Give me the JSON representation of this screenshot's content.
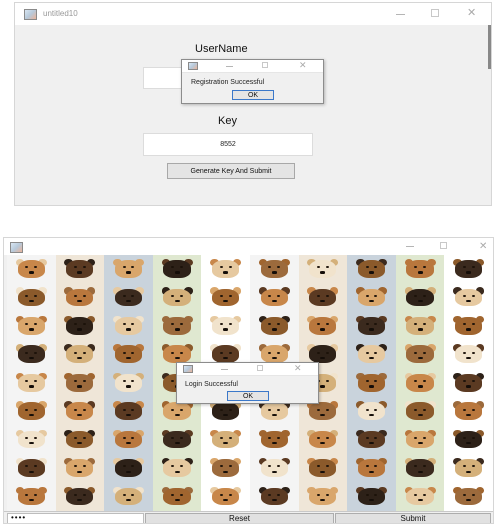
{
  "registration_window": {
    "title": "untitled10",
    "username_label": "UserName",
    "username_value": "",
    "key_label": "Key",
    "key_value": "8552",
    "generate_button": "Generate Key And Submit"
  },
  "registration_dialog": {
    "message": "Registration Successful",
    "ok_label": "OK"
  },
  "image_window": {
    "title": "",
    "password_value": "••••",
    "reset_label": "Reset",
    "submit_label": "Submit",
    "grid_columns": 10,
    "grid_rows": 9
  },
  "login_dialog": {
    "message": "Login Successful",
    "ok_label": "OK"
  },
  "window_controls": {
    "close_glyph": "✕"
  },
  "colors": {
    "window_bg": "#f0f0f0",
    "dialog_focus_border": "#3b78c9",
    "grid_bg": "#ffffff"
  },
  "icons": [
    "app-icon",
    "minimize-icon",
    "maximize-icon",
    "close-icon"
  ]
}
